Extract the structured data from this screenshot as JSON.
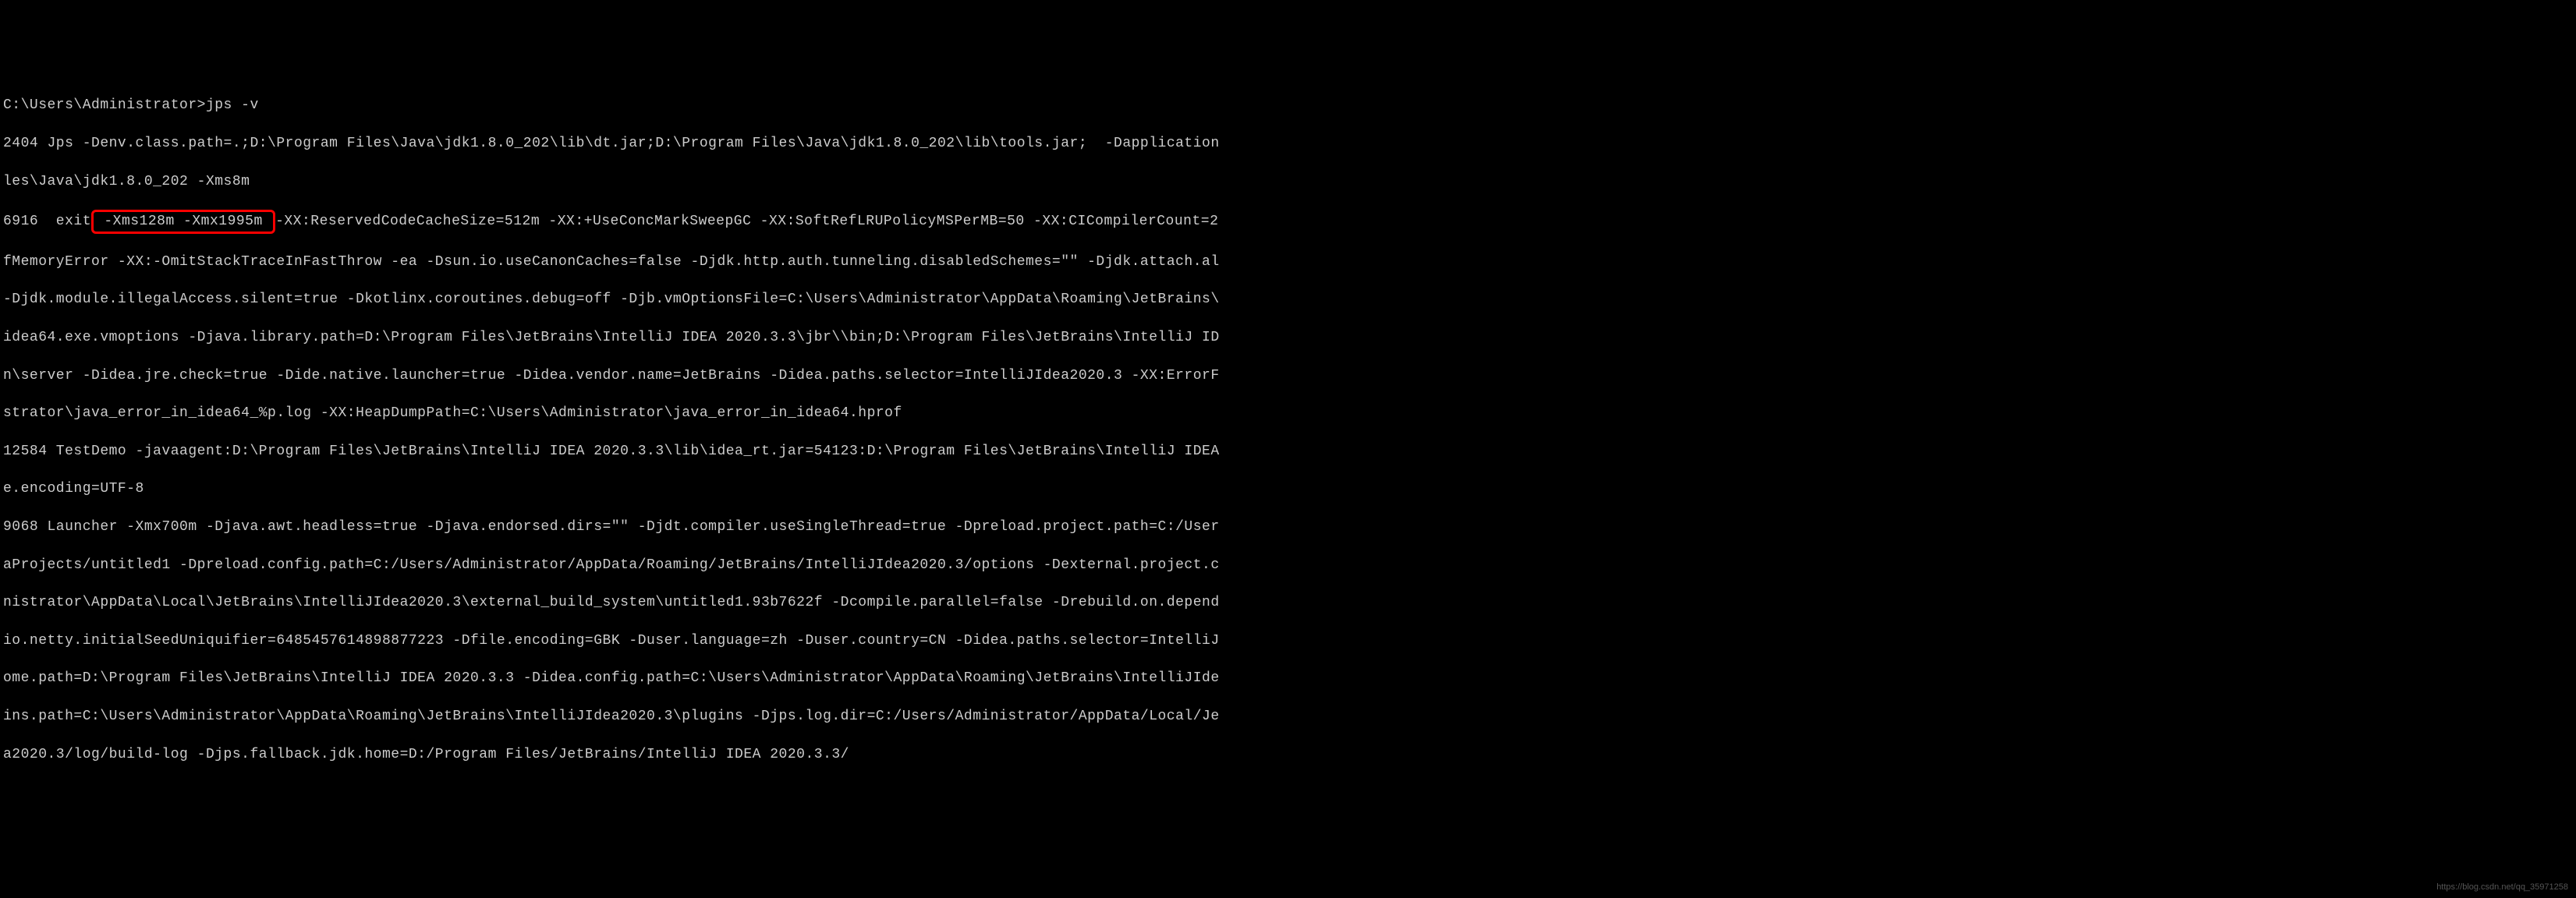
{
  "terminal": {
    "line1": "C:\\Users\\Administrator>jps -v",
    "line2": "2404 Jps -Denv.class.path=.;D:\\Program Files\\Java\\jdk1.8.0_202\\lib\\dt.jar;D:\\Program Files\\Java\\jdk1.8.0_202\\lib\\tools.jar;  -Dapplication",
    "line3": "les\\Java\\jdk1.8.0_202 -Xms8m",
    "line4_pre": "6916  exit",
    "line4_highlight": " -Xms128m -Xmx1995m ",
    "line4_post": "-XX:ReservedCodeCacheSize=512m -XX:+UseConcMarkSweepGC -XX:SoftRefLRUPolicyMSPerMB=50 -XX:CICompilerCount=2 ",
    "line5": "fMemoryError -XX:-OmitStackTraceInFastThrow -ea -Dsun.io.useCanonCaches=false -Djdk.http.auth.tunneling.disabledSchemes=\"\" -Djdk.attach.al",
    "line6": "-Djdk.module.illegalAccess.silent=true -Dkotlinx.coroutines.debug=off -Djb.vmOptionsFile=C:\\Users\\Administrator\\AppData\\Roaming\\JetBrains\\",
    "line7": "idea64.exe.vmoptions -Djava.library.path=D:\\Program Files\\JetBrains\\IntelliJ IDEA 2020.3.3\\jbr\\\\bin;D:\\Program Files\\JetBrains\\IntelliJ ID",
    "line8": "n\\server -Didea.jre.check=true -Dide.native.launcher=true -Didea.vendor.name=JetBrains -Didea.paths.selector=IntelliJIdea2020.3 -XX:ErrorF",
    "line9": "strator\\java_error_in_idea64_%p.log -XX:HeapDumpPath=C:\\Users\\Administrator\\java_error_in_idea64.hprof",
    "line10": "12584 TestDemo -javaagent:D:\\Program Files\\JetBrains\\IntelliJ IDEA 2020.3.3\\lib\\idea_rt.jar=54123:D:\\Program Files\\JetBrains\\IntelliJ IDEA",
    "line11": "e.encoding=UTF-8",
    "line12": "9068 Launcher -Xmx700m -Djava.awt.headless=true -Djava.endorsed.dirs=\"\" -Djdt.compiler.useSingleThread=true -Dpreload.project.path=C:/User",
    "line13": "aProjects/untitled1 -Dpreload.config.path=C:/Users/Administrator/AppData/Roaming/JetBrains/IntelliJIdea2020.3/options -Dexternal.project.c",
    "line14": "nistrator\\AppData\\Local\\JetBrains\\IntelliJIdea2020.3\\external_build_system\\untitled1.93b7622f -Dcompile.parallel=false -Drebuild.on.depend",
    "line15": "io.netty.initialSeedUniquifier=6485457614898877223 -Dfile.encoding=GBK -Duser.language=zh -Duser.country=CN -Didea.paths.selector=IntelliJ",
    "line16": "ome.path=D:\\Program Files\\JetBrains\\IntelliJ IDEA 2020.3.3 -Didea.config.path=C:\\Users\\Administrator\\AppData\\Roaming\\JetBrains\\IntelliJIde",
    "line17": "ins.path=C:\\Users\\Administrator\\AppData\\Roaming\\JetBrains\\IntelliJIdea2020.3\\plugins -Djps.log.dir=C:/Users/Administrator/AppData/Local/Je",
    "line18": "a2020.3/log/build-log -Djps.fallback.jdk.home=D:/Program Files/JetBrains/IntelliJ IDEA 2020.3.3/"
  },
  "watermark": "https://blog.csdn.net/qq_35971258"
}
